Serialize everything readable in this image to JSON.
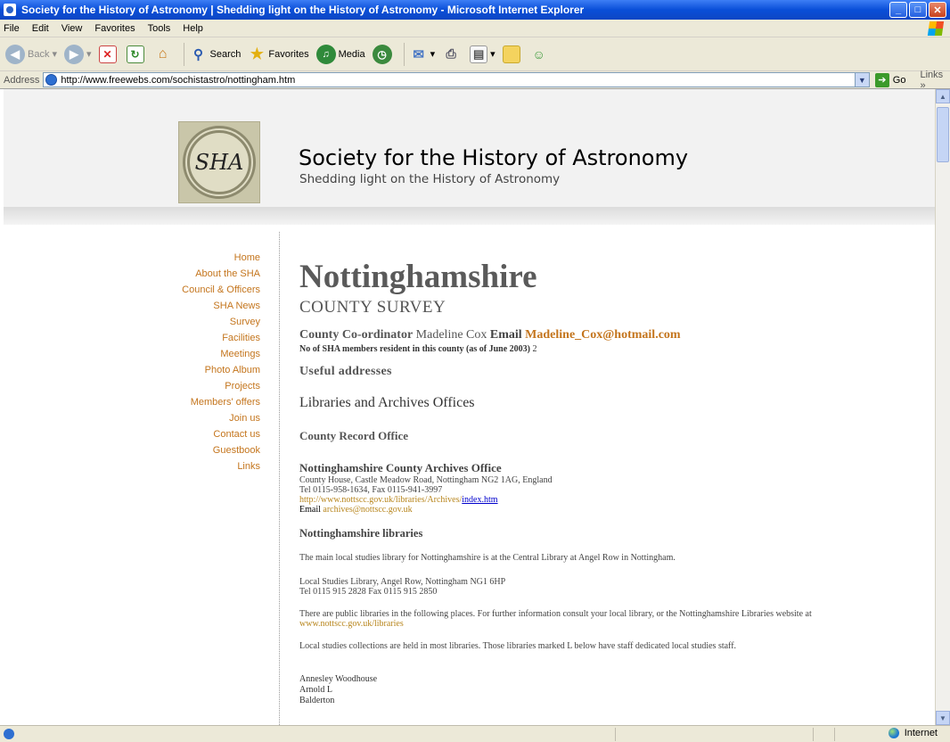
{
  "window": {
    "title": "Society for the History of Astronomy | Shedding light on the History of Astronomy - Microsoft Internet Explorer",
    "minimize": "_",
    "maximize": "□",
    "close": "✕"
  },
  "menu": [
    "File",
    "Edit",
    "View",
    "Favorites",
    "Tools",
    "Help"
  ],
  "toolbar": {
    "back": "Back",
    "search": "Search",
    "favorites": "Favorites",
    "media": "Media"
  },
  "address": {
    "label": "Address",
    "url": "http://www.freewebs.com/sochistastro/nottingham.htm",
    "go": "Go",
    "links": "Links"
  },
  "site": {
    "title": "Society for the History of Astronomy",
    "tagline": "Shedding light on the History of Astronomy"
  },
  "nav": [
    "Home",
    "About the SHA",
    "Council & Officers",
    "SHA News",
    "Survey",
    "Facilities",
    "Meetings",
    "Photo Album",
    "Projects",
    "Members' offers",
    "Join us",
    "Contact us",
    "Guestbook",
    "Links"
  ],
  "content": {
    "county": "Nottinghamshire",
    "subtitle": "COUNTY SURVEY",
    "coordinator_label": "County Co-ordinator",
    "coordinator_name": "Madeline Cox",
    "email_label": "Email",
    "email": "Madeline_Cox@hotmail.com",
    "members_label": "No of  SHA members resident in this county (as of June 2003)",
    "members_value": "2",
    "useful": "Useful addresses",
    "libraries_heading": "Libraries and Archives Offices",
    "record_office": "County Record Office",
    "archives_name": "Nottinghamshire County Archives Office",
    "archives_address": "County House, Castle Meadow Road,  Nottingham NG2 1AG,  England",
    "archives_tel": " Tel  0115-958-1634,  Fax 0115-941-3997",
    "archives_url_a": "http://www.nottscc.gov.uk/libraries/Archives/",
    "archives_url_b": "index.htm",
    "archives_email_label": "Email ",
    "archives_email": "archives@nottscc.gov.uk",
    "nlibs_heading": "Nottinghamshire libraries",
    "para1": "The main local studies library for Nottinghamshire is at the Central Library at Angel Row in Nottingham.",
    "para2_line1": "Local Studies Library, Angel Row, Nottingham NG1 6HP",
    "para2_line2": "Tel  0115 915 2828  Fax  0115 915 2850",
    "para3": "There are public libraries in the following places. For further information consult your local library, or the Nottinghamshire Libraries website at",
    "para3_link": "www.nottscc.gov.uk/libraries",
    "para4": "Local studies collections are held in most libraries. Those libraries marked L below have staff dedicated local studies staff.",
    "places": [
      "Annesley Woodhouse",
      " Arnold L",
      " Balderton"
    ]
  },
  "status": {
    "zone": "Internet"
  }
}
